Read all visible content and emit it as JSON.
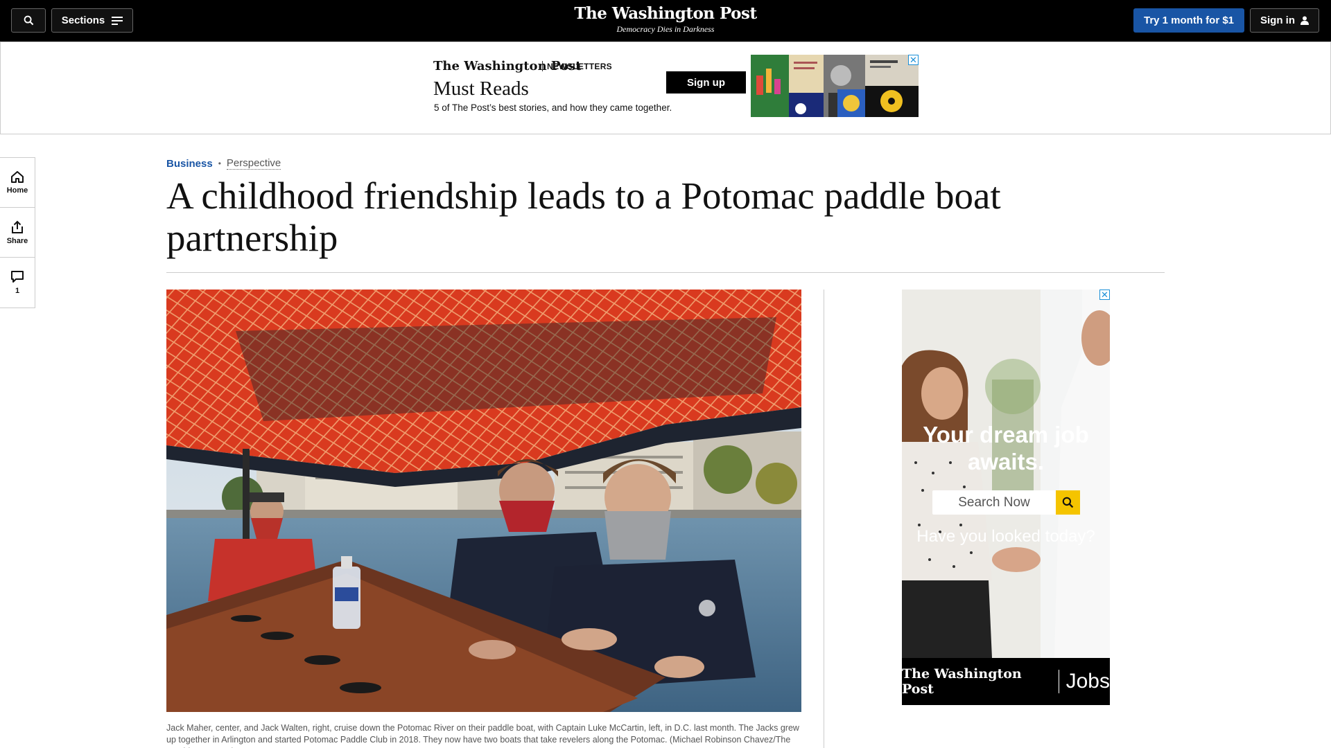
{
  "header": {
    "sections_label": "Sections",
    "logo": "The Washington Post",
    "tagline": "Democracy Dies in Darkness",
    "subscribe_label": "Try 1 month for $1",
    "signin_label": "Sign in"
  },
  "top_ad": {
    "logo": "The Washington Post",
    "label": "NEWSLETTERS",
    "title": "Must Reads",
    "subtitle": "5 of The Post’s best stories, and how they came together.",
    "cta": "Sign up",
    "close": "✕"
  },
  "rail": [
    {
      "label": "Home",
      "icon": "home-icon"
    },
    {
      "label": "Share",
      "icon": "share-icon"
    },
    {
      "label": "1",
      "icon": "comment-icon"
    }
  ],
  "article": {
    "section": "Business",
    "dot": "•",
    "label": "Perspective",
    "headline": "A childhood friendship leads to a Potomac paddle boat partnership",
    "caption": "Jack Maher, center, and Jack Walten, right, cruise down the Potomac River on their paddle boat, with Captain Luke McCartin, left, in D.C. last month. The Jacks grew up together in Arlington and started Potomac Paddle Club in 2018. They now have two boats that take revelers along the Potomac. (Michael Robinson Chavez/The Washington Post)"
  },
  "side_ad": {
    "headline": "Your dream job awaits.",
    "search_label": "Search Now",
    "tagline": "Have you looked today?",
    "logo": "The Washington Post",
    "word": "Jobs",
    "close": "✕"
  }
}
